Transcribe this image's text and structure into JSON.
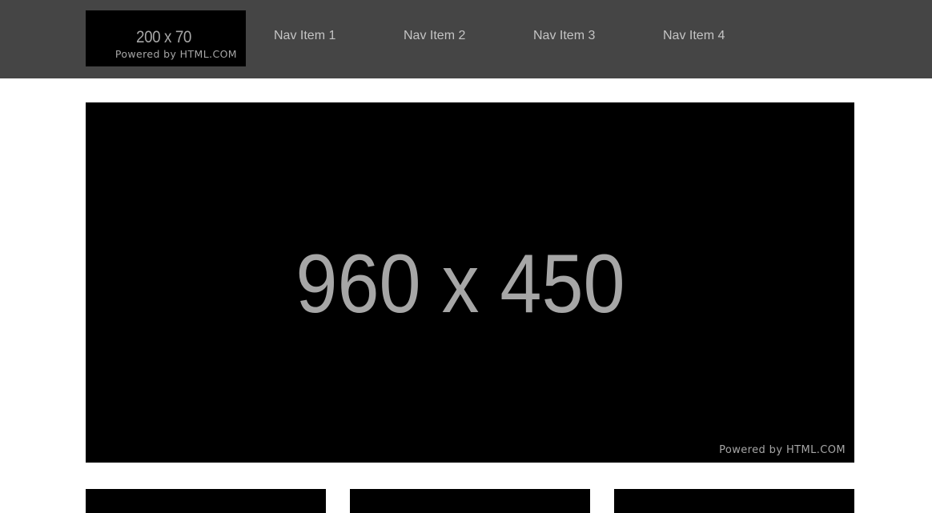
{
  "header": {
    "logo": {
      "size_label": "200 x 70",
      "powered_by": "Powered by HTML.COM"
    },
    "nav": [
      {
        "label": "Nav Item 1"
      },
      {
        "label": "Nav Item 2"
      },
      {
        "label": "Nav Item 3"
      },
      {
        "label": "Nav Item 4"
      }
    ]
  },
  "hero": {
    "size_label": "960 x 450",
    "powered_by": "Powered by HTML.COM"
  },
  "colors": {
    "header_bg": "#454545",
    "placeholder_bg": "#000000",
    "placeholder_text": "#a6a6a6",
    "nav_text": "#c4c4c4",
    "page_bg": "#ffffff"
  }
}
